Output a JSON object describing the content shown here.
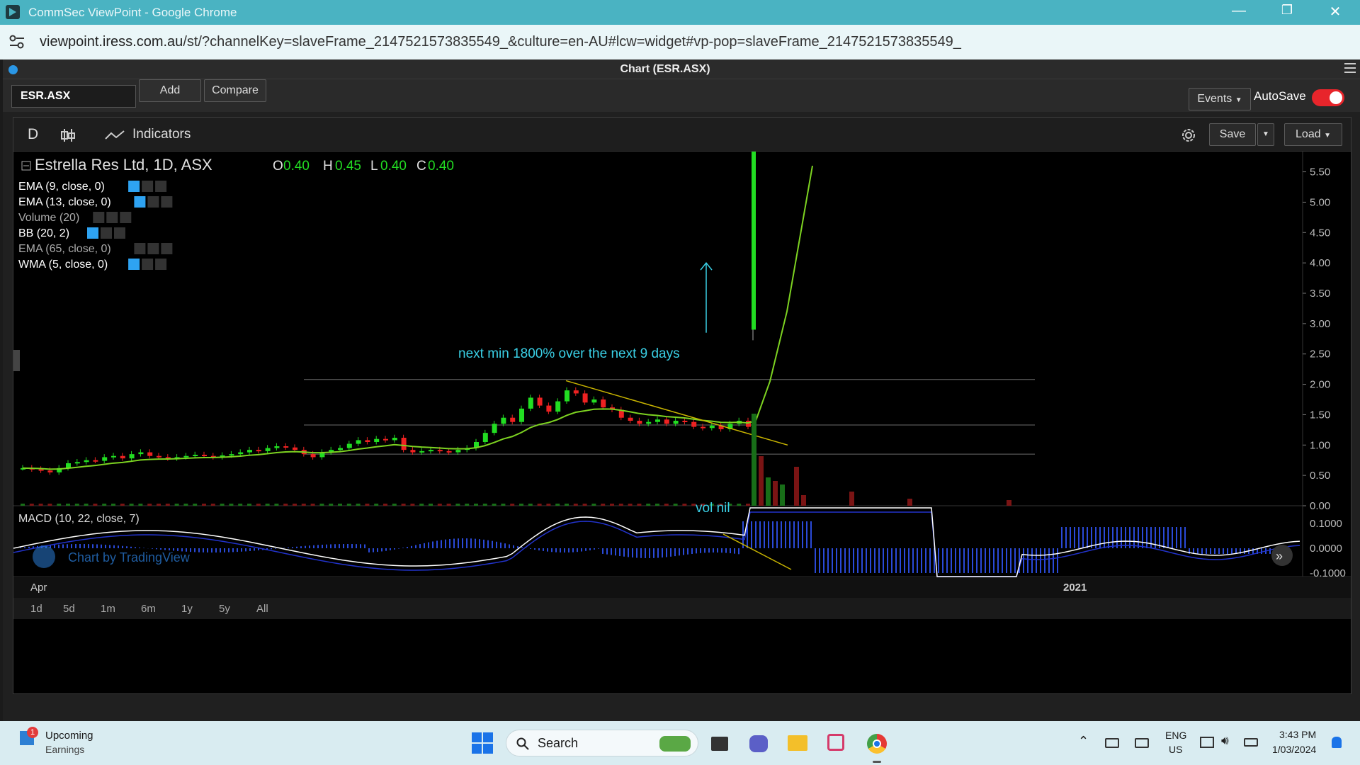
{
  "window": {
    "title": "CommSec ViewPoint - Google Chrome",
    "minimize": "—",
    "restore": "❐",
    "close": "✕"
  },
  "address": {
    "host": "viewpoint.iress.com.au",
    "path": "/st/?channelKey=slaveFrame_2147521573835549_&culture=en-AU#lcw=widget#vp-pop=slaveFrame_2147521573835549_"
  },
  "panel": {
    "title": "Chart (ESR.ASX)"
  },
  "toolbar": {
    "symbol": "ESR.ASX",
    "add": "Add",
    "compare": "Compare",
    "events": "Events",
    "autosave": "AutoSave",
    "autosave_on": true
  },
  "chart_toolbar": {
    "interval": "D",
    "indicators": "Indicators",
    "save": "Save",
    "load": "Load"
  },
  "legend": {
    "name": "Estrella Res Ltd, 1D, ASX",
    "o_label": "O",
    "o": "0.40",
    "h_label": "H",
    "h": "0.45",
    "l_label": "L",
    "l": "0.40",
    "c_label": "C",
    "c": "0.40",
    "indicators": [
      "EMA (9, close, 0)",
      "EMA (13, close, 0)",
      "Volume (20)",
      "BB (20, 2)",
      "EMA (65, close, 0)",
      "WMA (5, close, 0)"
    ],
    "macd": "MACD (10, 22, close, 7)"
  },
  "annotations": {
    "note": "next min 1800% over the next 9 days",
    "vol": "vol nil"
  },
  "watermark": "Chart by TradingView",
  "price_axis": [
    "5.50",
    "5.00",
    "4.50",
    "4.00",
    "3.50",
    "3.00",
    "2.50",
    "2.00",
    "1.50",
    "1.00",
    "0.50",
    "0.00"
  ],
  "macd_axis": [
    "0.1000",
    "0.0000",
    "-0.1000"
  ],
  "time_axis": [
    "Apr",
    "2021"
  ],
  "ranges": [
    "1d",
    "5d",
    "1m",
    "6m",
    "1y",
    "5y",
    "All"
  ],
  "colors": {
    "up": "#22dd22",
    "down": "#ee2222",
    "ma": "#7dd321",
    "annotation": "#3ad0e6",
    "trendline": "#c8b400"
  },
  "chart_data": {
    "type": "candlestick",
    "ylim": [
      0,
      5.6
    ],
    "closes": [
      0.62,
      0.6,
      0.58,
      0.55,
      0.62,
      0.7,
      0.72,
      0.75,
      0.74,
      0.8,
      0.82,
      0.78,
      0.85,
      0.88,
      0.82,
      0.8,
      0.78,
      0.8,
      0.82,
      0.84,
      0.82,
      0.8,
      0.83,
      0.85,
      0.88,
      0.92,
      0.9,
      0.95,
      0.98,
      0.96,
      0.92,
      0.85,
      0.8,
      0.88,
      0.92,
      0.95,
      1.02,
      1.08,
      1.05,
      1.1,
      1.08,
      1.12,
      0.92,
      0.88,
      0.9,
      0.92,
      0.9,
      0.88,
      0.92,
      0.95,
      1.05,
      1.2,
      1.35,
      1.45,
      1.38,
      1.6,
      1.78,
      1.65,
      1.55,
      1.72,
      1.9,
      1.85,
      1.7,
      1.75,
      1.62,
      1.58,
      1.45,
      1.4,
      1.35,
      1.38,
      1.42,
      1.35,
      1.4,
      1.38,
      1.3,
      1.28,
      1.32,
      1.26,
      1.35,
      1.4,
      1.3,
      2.9,
      4.0,
      5.6
    ],
    "spike_close": 2.9,
    "horizontal_levels": [
      2.08,
      1.33,
      0.85
    ]
  }
}
